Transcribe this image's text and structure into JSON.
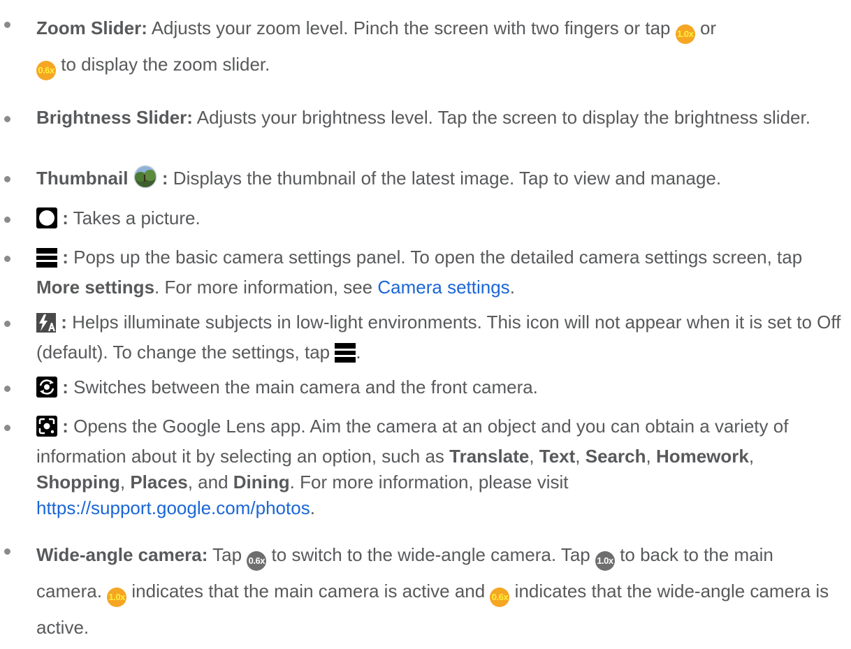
{
  "items": [
    {
      "bold": "Zoom Slider:",
      "t1": " Adjusts your zoom level. Pinch the screen with two fingers or tap ",
      "badge1": "1.0x",
      "t2": " or",
      "badge2": "0.6x",
      "t3": " to display the zoom slider."
    },
    {
      "bold": "Brightness Slider:",
      "t1": " Adjusts your brightness level. Tap the screen to display the brightness slider."
    },
    {
      "bold": "Thumbnail",
      "colon": " :",
      "t1": " Displays the thumbnail of the latest image. Tap to view and manage."
    },
    {
      "colon": " :",
      "t1": " Takes a picture."
    },
    {
      "colon": " :",
      "t1": " Pops up the basic camera settings panel. To open the detailed camera settings screen, tap ",
      "bold": "More settings",
      "t2": ". For more information, see ",
      "link": "Camera settings",
      "t3": "."
    },
    {
      "colon": " :",
      "t1": " Helps illuminate subjects in low-light environments. This icon will not appear when it is set to Off (default). To change the settings, tap ",
      "t2": "."
    },
    {
      "colon": " :",
      "t1": " Switches between the main camera and the front camera."
    },
    {
      "colon": " :",
      "t1": " Opens the Google Lens app. Aim the camera at an object and you can obtain a variety of information about it by selecting an option, such as ",
      "b1": "Translate",
      "b2": "Text",
      "b3": "Search",
      "b4": "Homework",
      "b5": "Shopping",
      "b6": "Places",
      "b7": "Dining",
      "sep": ", ",
      "and": ", and ",
      "t2": ". For more information, please visit ",
      "link": "https://support.google.com/photos",
      "t3": "."
    },
    {
      "bold": "Wide-angle camera:",
      "t1": " Tap ",
      "badge1": "0.6x",
      "t2": " to switch to the wide-angle camera. Tap ",
      "badge2": "1.0x",
      "t3": " to back to the main camera. ",
      "badge3": "1.0x",
      "t4": " indicates that the main camera is active and ",
      "badge4": "0.6x",
      "t5": " indicates that the wide-angle camera is active."
    }
  ],
  "colors": {
    "text": "#58595b",
    "link": "#1a66d6",
    "badge_active": "#f5a623",
    "badge_text_active": "#ffef3a",
    "badge_gray": "#6e6e6e"
  },
  "icons": [
    "thumbnail-photo-icon",
    "shutter-icon",
    "menu-icon",
    "flash-auto-icon",
    "switch-camera-icon",
    "google-lens-icon"
  ]
}
